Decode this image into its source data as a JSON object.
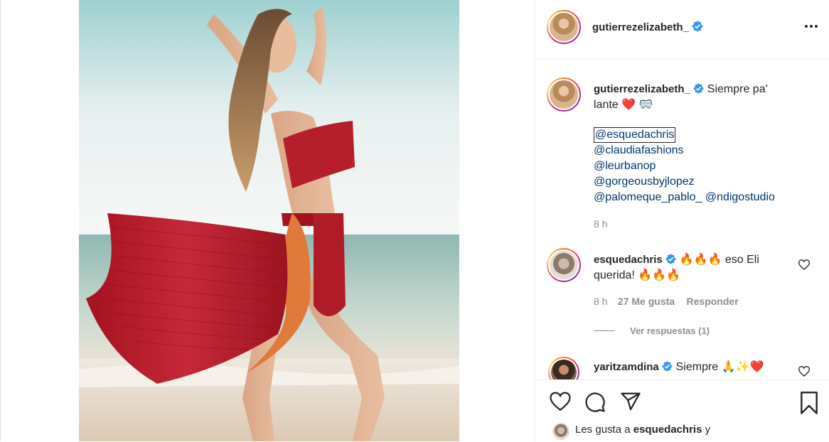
{
  "post": {
    "author": "gutierrezelizabeth_",
    "caption_text": "Siempre pa' lante",
    "caption_line1": "Siempre pa'",
    "caption_line2": "lante",
    "caption_emojis": "❤️ 🥽",
    "mentions": [
      "@esquedachris",
      "@claudiafashions",
      "@leurbanop",
      "@gorgeousbyjlopez"
    ],
    "mention_last_a": "@palomeque_pablo_",
    "mention_last_b": "@ndigostudio",
    "time": "8 h"
  },
  "comments": [
    {
      "user": "esquedachris",
      "text_line1": "eso Eli",
      "text_line2": "querida!",
      "emoji1": "🔥🔥🔥",
      "emoji2": "🔥🔥🔥",
      "time": "8 h",
      "likes": "27 Me gusta",
      "reply": "Responder",
      "view_replies": "Ver respuestas (1)"
    },
    {
      "user": "yaritzamdina",
      "text": "Siempre",
      "emoji": "🙏✨❤️"
    }
  ],
  "likes_bar": {
    "prefix": "Les gusta a",
    "user": "esquedachris",
    "suffix": "y"
  },
  "colors": {
    "verified": "#3897f0",
    "link": "#00376b",
    "muted": "#8e8e8e"
  },
  "icons": [
    "more-options-icon",
    "heart-icon",
    "comment-icon",
    "share-icon",
    "bookmark-icon",
    "verified-icon"
  ]
}
